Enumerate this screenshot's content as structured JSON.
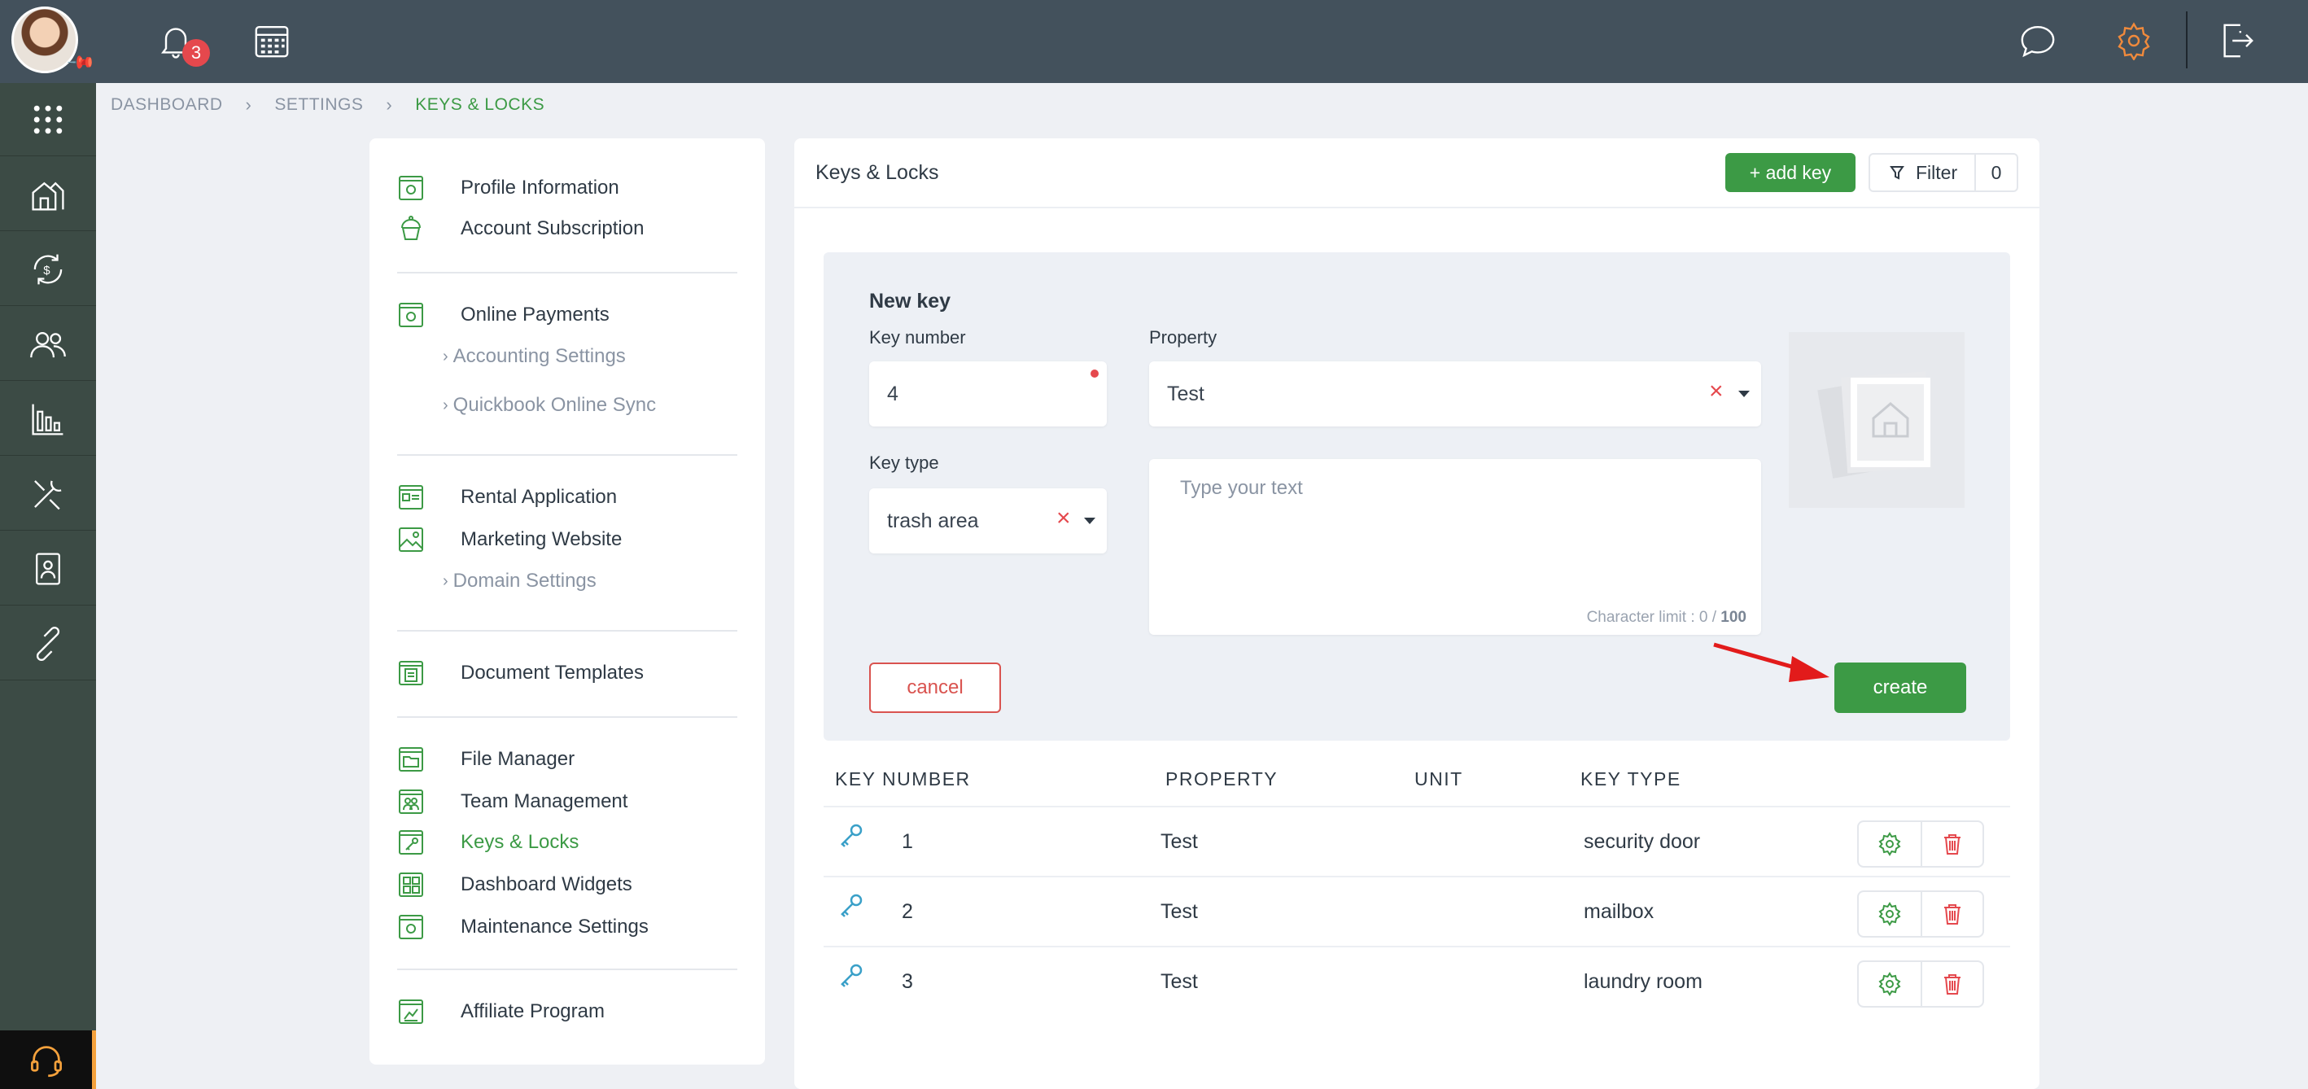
{
  "topbar": {
    "notification_count": "3",
    "icons": [
      "bell-icon",
      "calendar-icon",
      "chat-icon",
      "gear-icon",
      "logout-icon"
    ]
  },
  "sidebar_nav": [
    "apps-grid-icon",
    "properties-icon",
    "payments-icon",
    "tenants-icon",
    "reports-icon",
    "maintenance-icon",
    "documents-icon",
    "link-icon",
    "support-icon"
  ],
  "breadcrumb": {
    "items": [
      "DASHBOARD",
      "SETTINGS",
      "KEYS & LOCKS"
    ]
  },
  "settings_menu": {
    "profile_information": "Profile Information",
    "account_subscription": "Account Subscription",
    "online_payments": "Online Payments",
    "accounting_settings": "Accounting Settings",
    "quickbook_online_sync": "Quickbook Online Sync",
    "rental_application": "Rental Application",
    "marketing_website": "Marketing Website",
    "domain_settings": "Domain Settings",
    "document_templates": "Document Templates",
    "file_manager": "File Manager",
    "team_management": "Team Management",
    "keys_locks": "Keys & Locks",
    "dashboard_widgets": "Dashboard Widgets",
    "maintenance_settings": "Maintenance Settings",
    "affiliate_program": "Affiliate Program"
  },
  "main": {
    "title": "Keys & Locks",
    "add_key_label": "+ add key",
    "filter_label": "Filter",
    "filter_count": "0"
  },
  "form": {
    "title": "New key",
    "key_number_label": "Key number",
    "key_number_value": "4",
    "property_label": "Property",
    "property_value": "Test",
    "key_type_label": "Key type",
    "key_type_value": "trash area",
    "text_placeholder": "Type your text",
    "char_limit_prefix": "Character limit : 0 /",
    "char_limit_max": "100",
    "cancel_label": "cancel",
    "create_label": "create"
  },
  "table": {
    "headers": {
      "key_number": "KEY NUMBER",
      "property": "PROPERTY",
      "unit": "UNIT",
      "key_type": "KEY TYPE"
    },
    "rows": [
      {
        "key_number": "1",
        "property": "Test",
        "unit": "",
        "key_type": "security door"
      },
      {
        "key_number": "2",
        "property": "Test",
        "unit": "",
        "key_type": "mailbox"
      },
      {
        "key_number": "3",
        "property": "Test",
        "unit": "",
        "key_type": "laundry room"
      }
    ]
  },
  "colors": {
    "accent_green": "#3c9a45",
    "danger_red": "#e5484d",
    "topbar_bg": "#43515c",
    "nav_bg": "#3c4b45",
    "gear_orange": "#f08a3c"
  }
}
